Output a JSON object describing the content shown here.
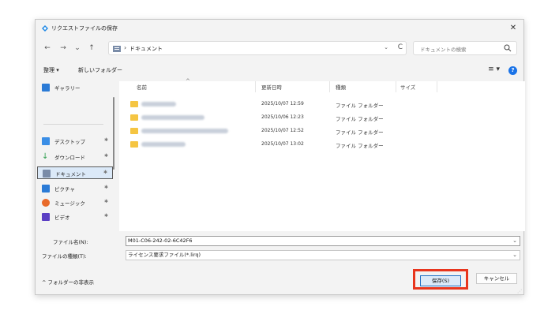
{
  "window": {
    "title": "リクエストファイルの保存",
    "close_glyph": "✕"
  },
  "nav": {
    "back": "←",
    "forward": "→",
    "recent": "⌄",
    "up": "↑",
    "breadcrumb_separator": "›",
    "breadcrumb": "ドキュメント",
    "dropdown": "⌄",
    "refresh": "C",
    "search_placeholder": "ドキュメントの検索"
  },
  "toolbar": {
    "organize": "整理 ▾",
    "new_folder": "新しいフォルダー",
    "view_menu": "≡ ▾",
    "help": "?"
  },
  "sidebar": {
    "items": [
      {
        "label": "ギャラリー",
        "icon": "gallery-icon",
        "color": "#2b7bd6",
        "pinned": false
      },
      {
        "label": "デスクトップ",
        "icon": "desktop-icon",
        "color": "#3a8ee6",
        "pinned": true
      },
      {
        "label": "ダウンロード",
        "icon": "download-icon",
        "color": "#2a9d4a",
        "pinned": true
      },
      {
        "label": "ドキュメント",
        "icon": "documents-icon",
        "color": "#7a8ca8",
        "pinned": true
      },
      {
        "label": "ピクチャ",
        "icon": "pictures-icon",
        "color": "#2b7bd6",
        "pinned": true
      },
      {
        "label": "ミュージック",
        "icon": "music-icon",
        "color": "#e86a2a",
        "pinned": true
      },
      {
        "label": "ビデオ",
        "icon": "video-icon",
        "color": "#5b3fc4",
        "pinned": true
      }
    ],
    "pin_glyph": "✱"
  },
  "file_list": {
    "columns": [
      "名前",
      "更新日時",
      "種類",
      "サイズ"
    ],
    "sort_glyph": "^",
    "rows": [
      {
        "date": "2025/10/07 12:59",
        "type": "ファイル フォルダー"
      },
      {
        "date": "2025/10/06 12:23",
        "type": "ファイル フォルダー"
      },
      {
        "date": "2025/10/07 12:52",
        "type": "ファイル フォルダー"
      },
      {
        "date": "2025/10/07 13:02",
        "type": "ファイル フォルダー"
      }
    ]
  },
  "form": {
    "filename_label": "ファイル名(N):",
    "filename_value": "M01-C06-242-02-6C42F6",
    "filetype_label": "ファイルの種類(T):",
    "filetype_value": "ライセンス要求ファイル(*.lirq)",
    "dropdown": "⌄"
  },
  "footer": {
    "hide_folders": "^  フォルダーの非表示",
    "save": "保存(S)",
    "cancel": "キャンセル",
    "grip": "⋰"
  },
  "colors": {
    "accent": "#1f6fc5",
    "highlight_border": "#e8351d",
    "folder": "#f5c542"
  }
}
